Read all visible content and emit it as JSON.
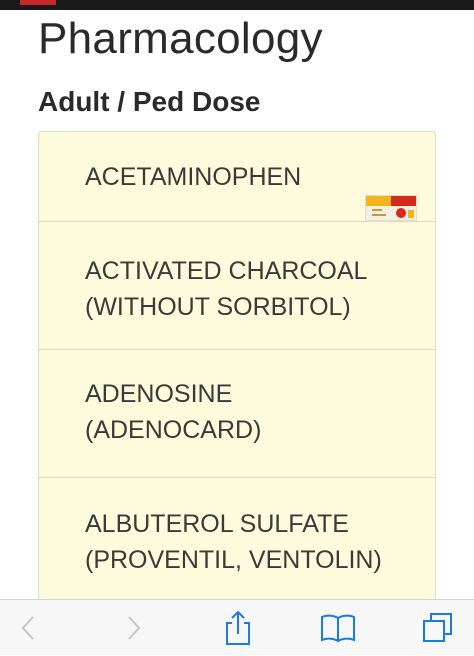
{
  "page": {
    "title": "Pharmacology",
    "section": "Adult / Ped Dose"
  },
  "drugs": [
    {
      "line1": "ACETAMINOPHEN",
      "line2": ""
    },
    {
      "line1": "ACTIVATED CHARCOAL",
      "line2": "(WITHOUT SORBITOL)"
    },
    {
      "line1": "ADENOSINE",
      "line2": "(ADENOCARD)"
    },
    {
      "line1": "ALBUTEROL SULFATE",
      "line2": "(PROVENTIL, VENTOLIN)"
    }
  ],
  "toolbar": {
    "icons": [
      "back-icon",
      "forward-icon",
      "share-icon",
      "bookmarks-icon",
      "tabs-icon"
    ]
  },
  "colors": {
    "list_background": "#fdfbdc",
    "toolbar_icon_active": "#1a7ae6",
    "toolbar_icon_disabled": "#c4c4c4"
  }
}
